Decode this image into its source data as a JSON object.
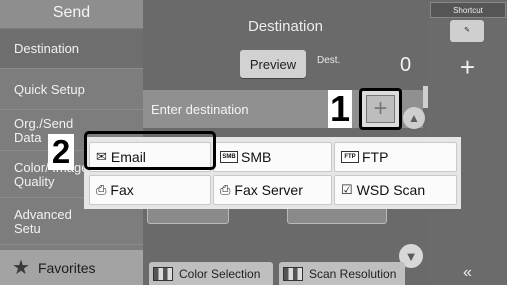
{
  "sidebar": {
    "title": "Send",
    "items": [
      {
        "label": "Destination"
      },
      {
        "label": "Quick Setup"
      },
      {
        "label": "Org./Send Data"
      },
      {
        "label": "Color/ Image Quality"
      },
      {
        "label": "Advanced Setu"
      }
    ],
    "favorites_label": "Favorites"
  },
  "main": {
    "title": "Destination",
    "preview_label": "Preview",
    "dest_label": "Dest.",
    "dest_count": "0",
    "enter_destination": "Enter destination",
    "bottom_buttons": [
      "Color Selection",
      "Scan Resolution"
    ]
  },
  "popup": {
    "options": [
      {
        "label": "Email",
        "icon": "envelope-icon"
      },
      {
        "label": "SMB",
        "icon": "smb-icon",
        "icon_text": "SMB"
      },
      {
        "label": "FTP",
        "icon": "ftp-icon",
        "icon_text": "FTP"
      },
      {
        "label": "Fax",
        "icon": "fax-icon"
      },
      {
        "label": "Fax Server",
        "icon": "fax-server-icon"
      },
      {
        "label": "WSD Scan",
        "icon": "wsd-scan-icon"
      }
    ]
  },
  "right_panel": {
    "shortcut_label": "Shortcut",
    "add_label": "+",
    "collapse_label": "«"
  },
  "callouts": {
    "one": "1",
    "two": "2"
  },
  "colors": {
    "panel_bg": "#6b6b6b",
    "sidebar_bg": "#7d7d7d",
    "popup_bg": "#e6e6e6",
    "button_bg": "#fbfbfb"
  }
}
